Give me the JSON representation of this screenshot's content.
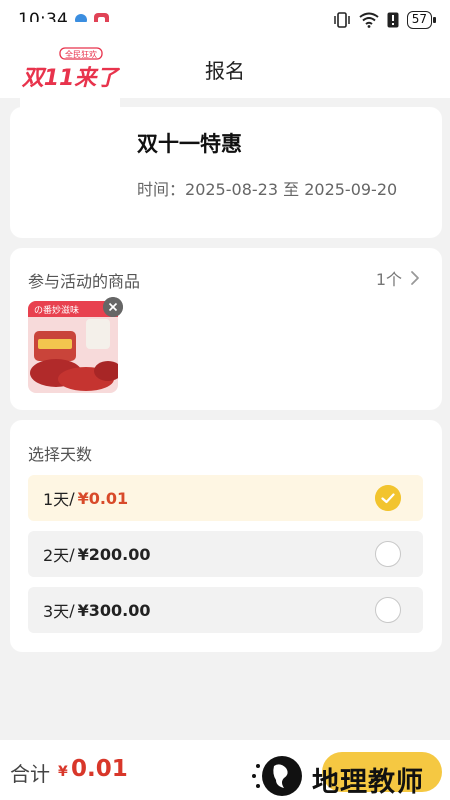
{
  "status_bar": {
    "time": "10:34",
    "battery": "57"
  },
  "nav": {
    "title": "报名",
    "back_icon": "chevron-left-icon"
  },
  "event": {
    "name": "双十一特惠",
    "time_label": "时间：",
    "start_date": "2025-08-23",
    "to": "至",
    "end_date": "2025-09-20",
    "logo_text_top": "全民狂欢",
    "logo_text_main": "双11来了"
  },
  "goods": {
    "label": "参与活动的商品",
    "count": "1个",
    "thumb_text": "の番妙滋味"
  },
  "days": {
    "label": "选择天数",
    "options": [
      {
        "days": "1天",
        "sep": "/",
        "price": "¥0.01",
        "selected": true
      },
      {
        "days": "2天",
        "sep": "/",
        "price": "¥200.00",
        "selected": false
      },
      {
        "days": "3天",
        "sep": "/",
        "price": "¥300.00",
        "selected": false
      }
    ]
  },
  "footer": {
    "total_label": "合计",
    "currency": "¥",
    "total": "0.01",
    "watermark": "地理教师"
  },
  "colors": {
    "accent": "#f5c842",
    "price_red": "#d8372a",
    "selected_bg": "#fef6e3"
  }
}
